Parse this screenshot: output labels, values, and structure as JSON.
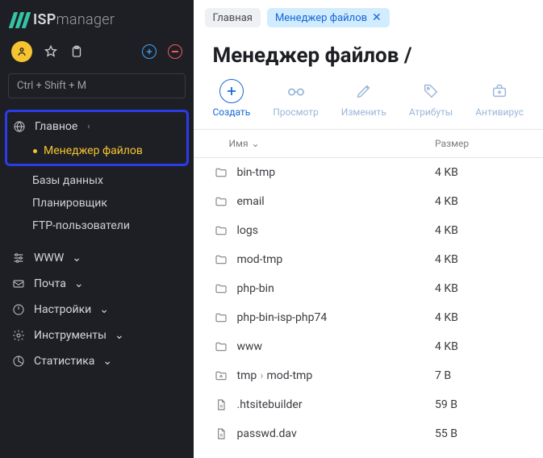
{
  "brand": {
    "name_strong": "ISP",
    "name_light": "manager"
  },
  "shortcut": "Ctrl + Shift + M",
  "sidebar": {
    "main_label": "Главное",
    "items": [
      "Менеджер файлов",
      "Базы данных",
      "Планировщик",
      "FTP-пользователи"
    ],
    "cats": [
      {
        "label": "WWW"
      },
      {
        "label": "Почта"
      },
      {
        "label": "Настройки"
      },
      {
        "label": "Инструменты"
      },
      {
        "label": "Статистика"
      }
    ]
  },
  "tabs": {
    "home": "Главная",
    "active": "Менеджер файлов"
  },
  "page": {
    "title": "Менеджер файлов /"
  },
  "toolbar": {
    "create": "Создать",
    "view": "Просмотр",
    "edit": "Изменить",
    "attrs": "Атрибуты",
    "antivirus": "Антивирус"
  },
  "columns": {
    "name": "Имя",
    "size": "Размер"
  },
  "files": [
    {
      "type": "folder",
      "name": "bin-tmp",
      "size": "4 KB"
    },
    {
      "type": "folder",
      "name": "email",
      "size": "4 KB"
    },
    {
      "type": "folder",
      "name": "logs",
      "size": "4 KB"
    },
    {
      "type": "folder",
      "name": "mod-tmp",
      "size": "4 KB"
    },
    {
      "type": "folder",
      "name": "php-bin",
      "size": "4 KB"
    },
    {
      "type": "folder",
      "name": "php-bin-isp-php74",
      "size": "4 KB"
    },
    {
      "type": "folder",
      "name": "www",
      "size": "4 KB"
    },
    {
      "type": "symlink",
      "name": "tmp",
      "target": "mod-tmp",
      "size": "7 B"
    },
    {
      "type": "file",
      "name": ".htsitebuilder",
      "size": "59 B"
    },
    {
      "type": "file",
      "name": "passwd.dav",
      "size": "55 B"
    }
  ]
}
